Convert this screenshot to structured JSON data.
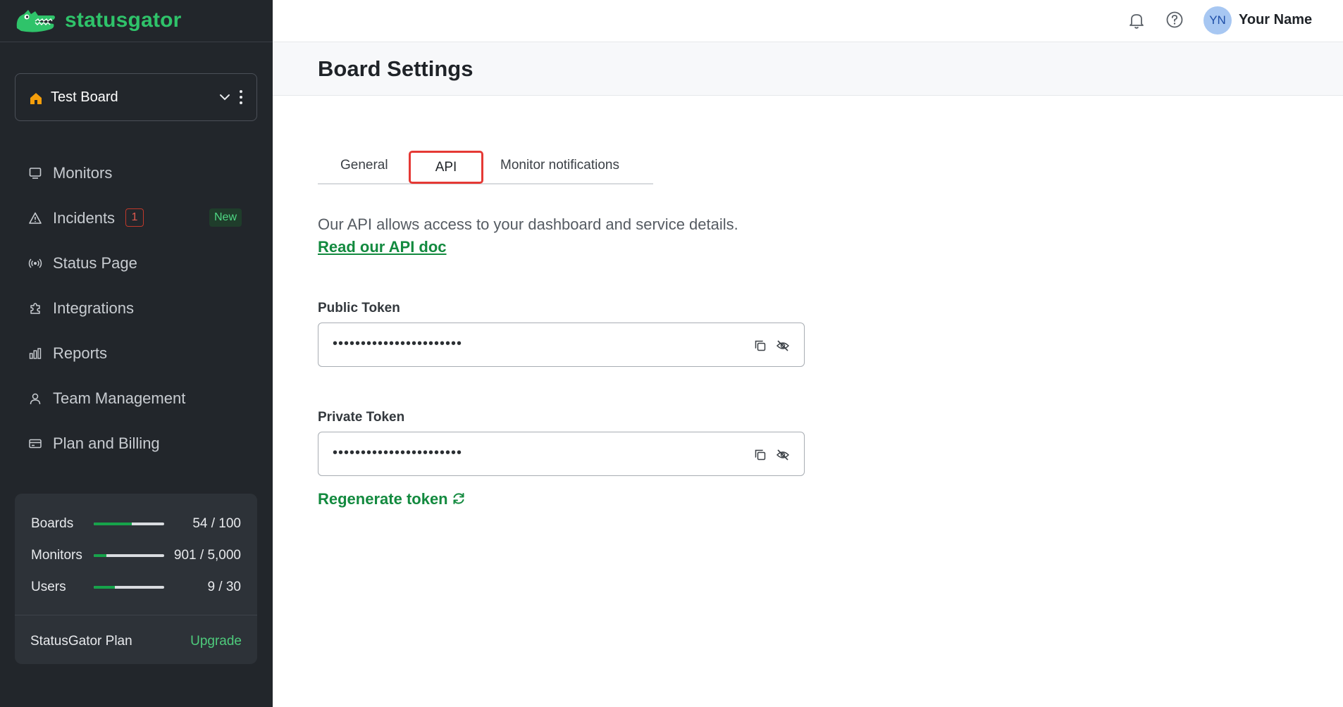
{
  "app": {
    "logo_text": "statusgator",
    "brand_color": "#2fc36a",
    "accent_color": "#138a3f"
  },
  "board_select": {
    "name": "Test Board",
    "icon": "home-icon"
  },
  "sidebar": {
    "items": [
      {
        "label": "Monitors",
        "icon": "monitor-icon"
      },
      {
        "label": "Incidents",
        "icon": "warning-triangle-icon",
        "count": "1",
        "badge": "New"
      },
      {
        "label": "Status Page",
        "icon": "broadcast-icon"
      },
      {
        "label": "Integrations",
        "icon": "puzzle-icon"
      },
      {
        "label": "Reports",
        "icon": "bar-chart-icon"
      },
      {
        "label": "Team Management",
        "icon": "user-icon"
      },
      {
        "label": "Plan and Billing",
        "icon": "credit-card-icon"
      }
    ]
  },
  "usage": {
    "rows": [
      {
        "label": "Boards",
        "value": "54 / 100",
        "fraction": 0.54
      },
      {
        "label": "Monitors",
        "value": "901 / 5,000",
        "fraction": 0.18
      },
      {
        "label": "Users",
        "value": "9 / 30",
        "fraction": 0.3
      }
    ],
    "plan_label": "StatusGator Plan",
    "upgrade_label": "Upgrade"
  },
  "header": {
    "avatar_initials": "YN",
    "user_name": "Your Name"
  },
  "page": {
    "title": "Board Settings",
    "tabs": [
      {
        "label": "General"
      },
      {
        "label": "API",
        "selected": true
      },
      {
        "label": "Monitor notifications"
      }
    ],
    "description": "Our API allows access to your dashboard and service details.",
    "doc_link": "Read our API doc",
    "public_token": {
      "label": "Public Token",
      "value": "•••••••••••••••••••••••"
    },
    "private_token": {
      "label": "Private Token",
      "value": "•••••••••••••••••••••••"
    },
    "regenerate_label": "Regenerate token"
  }
}
